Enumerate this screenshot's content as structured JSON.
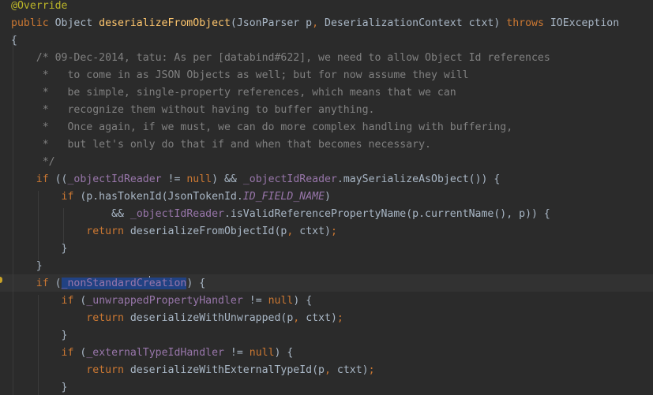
{
  "editor": {
    "lines": [
      {
        "indent": "",
        "tokens": [
          {
            "c": "ann",
            "t": "@Override"
          }
        ]
      },
      {
        "indent": "",
        "tokens": [
          {
            "c": "kw",
            "t": "public "
          },
          {
            "c": "",
            "t": "Object "
          },
          {
            "c": "fn",
            "t": "deserializeFromObject"
          },
          {
            "c": "",
            "t": "(JsonParser p"
          },
          {
            "c": "kw",
            "t": ", "
          },
          {
            "c": "",
            "t": "DeserializationContext ctxt) "
          },
          {
            "c": "kw",
            "t": "throws "
          },
          {
            "c": "",
            "t": "IOException"
          }
        ]
      },
      {
        "indent": "",
        "tokens": [
          {
            "c": "",
            "t": "{"
          }
        ]
      },
      {
        "indent": "    ",
        "tokens": [
          {
            "c": "cmt",
            "t": "/* 09-Dec-2014, tatu: As per [databind#622], we need to allow Object Id references"
          }
        ]
      },
      {
        "indent": "    ",
        "tokens": [
          {
            "c": "cmt",
            "t": " *   to come in as JSON Objects as well; but for now assume they will"
          }
        ]
      },
      {
        "indent": "    ",
        "tokens": [
          {
            "c": "cmt",
            "t": " *   be simple, single-property references, which means that we can"
          }
        ]
      },
      {
        "indent": "    ",
        "tokens": [
          {
            "c": "cmt",
            "t": " *   recognize them without having to buffer anything."
          }
        ]
      },
      {
        "indent": "    ",
        "tokens": [
          {
            "c": "cmt",
            "t": " *   Once again, if we must, we can do more complex handling with buffering,"
          }
        ]
      },
      {
        "indent": "    ",
        "tokens": [
          {
            "c": "cmt",
            "t": " *   but let's only do that if and when that becomes necessary."
          }
        ]
      },
      {
        "indent": "    ",
        "tokens": [
          {
            "c": "cmt",
            "t": " */"
          }
        ]
      },
      {
        "indent": "    ",
        "tokens": [
          {
            "c": "kw",
            "t": "if "
          },
          {
            "c": "",
            "t": "(("
          },
          {
            "c": "fld",
            "t": "_objectIdReader"
          },
          {
            "c": "",
            "t": " != "
          },
          {
            "c": "kw",
            "t": "null"
          },
          {
            "c": "",
            "t": ") && "
          },
          {
            "c": "fld",
            "t": "_objectIdReader"
          },
          {
            "c": "",
            "t": ".maySerializeAsObject()) {"
          }
        ]
      },
      {
        "indent": "        ",
        "tokens": [
          {
            "c": "kw",
            "t": "if "
          },
          {
            "c": "",
            "t": "(p.hasTokenId(JsonTokenId."
          },
          {
            "c": "cst",
            "t": "ID_FIELD_NAME"
          },
          {
            "c": "",
            "t": ")"
          }
        ]
      },
      {
        "indent": "                ",
        "tokens": [
          {
            "c": "",
            "t": "&& "
          },
          {
            "c": "fld",
            "t": "_objectIdReader"
          },
          {
            "c": "",
            "t": ".isValidReferencePropertyName(p.currentName(), p)) {"
          }
        ]
      },
      {
        "indent": "            ",
        "tokens": [
          {
            "c": "kw",
            "t": "return "
          },
          {
            "c": "",
            "t": "deserializeFromObjectId(p"
          },
          {
            "c": "kw",
            "t": ", "
          },
          {
            "c": "",
            "t": "ctxt)"
          },
          {
            "c": "kw",
            "t": ";"
          }
        ]
      },
      {
        "indent": "        ",
        "tokens": [
          {
            "c": "",
            "t": "}"
          }
        ]
      },
      {
        "indent": "    ",
        "tokens": [
          {
            "c": "",
            "t": "}"
          }
        ]
      },
      {
        "indent": "    ",
        "tokens": [
          {
            "c": "kw",
            "t": "if "
          },
          {
            "c": "",
            "t": "("
          },
          {
            "c": "fld sel",
            "t": "_nonStandardCr"
          },
          {
            "c": "caret",
            "t": ""
          },
          {
            "c": "fld sel",
            "t": "eation"
          },
          {
            "c": "",
            "t": ") {"
          }
        ]
      },
      {
        "indent": "        ",
        "tokens": [
          {
            "c": "kw",
            "t": "if "
          },
          {
            "c": "",
            "t": "("
          },
          {
            "c": "fld",
            "t": "_unwrappedPropertyHandler"
          },
          {
            "c": "",
            "t": " != "
          },
          {
            "c": "kw",
            "t": "null"
          },
          {
            "c": "",
            "t": ") {"
          }
        ]
      },
      {
        "indent": "            ",
        "tokens": [
          {
            "c": "kw",
            "t": "return "
          },
          {
            "c": "",
            "t": "deserializeWithUnwrapped(p"
          },
          {
            "c": "kw",
            "t": ", "
          },
          {
            "c": "",
            "t": "ctxt)"
          },
          {
            "c": "kw",
            "t": ";"
          }
        ]
      },
      {
        "indent": "        ",
        "tokens": [
          {
            "c": "",
            "t": "}"
          }
        ]
      },
      {
        "indent": "        ",
        "tokens": [
          {
            "c": "kw",
            "t": "if "
          },
          {
            "c": "",
            "t": "("
          },
          {
            "c": "fld",
            "t": "_externalTypeIdHandler"
          },
          {
            "c": "",
            "t": " != "
          },
          {
            "c": "kw",
            "t": "null"
          },
          {
            "c": "",
            "t": ") {"
          }
        ]
      },
      {
        "indent": "            ",
        "tokens": [
          {
            "c": "kw",
            "t": "return "
          },
          {
            "c": "",
            "t": "deserializeWithExternalTypeId(p"
          },
          {
            "c": "kw",
            "t": ", "
          },
          {
            "c": "",
            "t": "ctxt)"
          },
          {
            "c": "kw",
            "t": ";"
          }
        ]
      },
      {
        "indent": "        ",
        "tokens": [
          {
            "c": "",
            "t": "}"
          }
        ]
      }
    ]
  }
}
